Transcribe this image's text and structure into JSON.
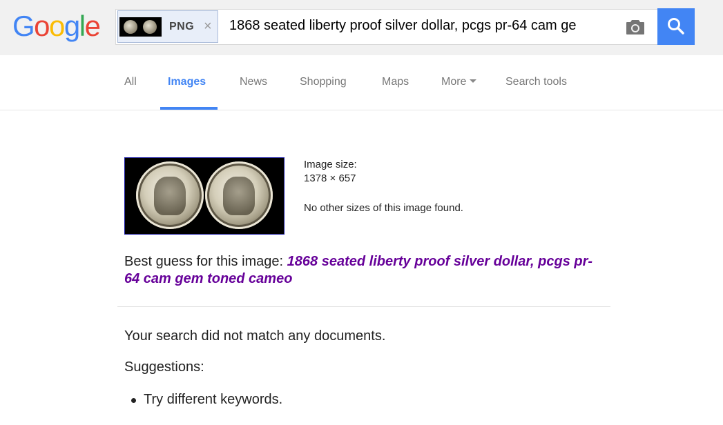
{
  "logo": {
    "letters": [
      "G",
      "o",
      "o",
      "g",
      "l",
      "e"
    ],
    "colors": [
      "#4285f4",
      "#ea4335",
      "#fbbc05",
      "#4285f4",
      "#34a853",
      "#ea4335"
    ]
  },
  "search": {
    "chip_label": "PNG",
    "chip_close": "×",
    "query": "1868 seated liberty proof silver dollar, pcgs pr-64 cam ge",
    "accent": "#4285f4"
  },
  "nav": {
    "tabs": [
      {
        "label": "All"
      },
      {
        "label": "Images"
      },
      {
        "label": "News"
      },
      {
        "label": "Shopping"
      },
      {
        "label": "Maps"
      },
      {
        "label": "More"
      },
      {
        "label": "Search tools"
      }
    ],
    "active": "Images"
  },
  "result": {
    "image_size_label": "Image size:",
    "image_size_value": "1378 × 657",
    "no_sizes": "No other sizes of this image found.",
    "best_guess_prefix": "Best guess for this image: ",
    "best_guess_link": "1868 seated liberty proof silver dollar, pcgs pr-64 cam gem toned cameo",
    "link_color": "#660099"
  },
  "message": {
    "no_match": "Your search did not match any documents.",
    "suggestions_title": "Suggestions:",
    "suggestions": [
      "Try different keywords."
    ]
  }
}
